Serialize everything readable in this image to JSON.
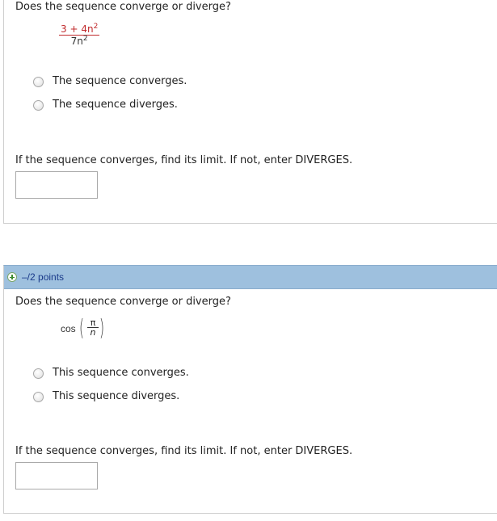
{
  "question1": {
    "prompt": "Does the sequence converge or diverge?",
    "expression": {
      "numerator": "3 + 4n",
      "numerator_exp": "2",
      "denominator": "7n",
      "denominator_exp": "2"
    },
    "options": [
      "The sequence converges.",
      "The sequence diverges."
    ],
    "limit_prompt": "If the sequence converges, find its limit. If not, enter DIVERGES.",
    "answer_value": ""
  },
  "question2": {
    "points": "–/2 points",
    "prompt": "Does the sequence converge or diverge?",
    "expression": {
      "func": "cos",
      "numerator": "π",
      "denominator": "n"
    },
    "options": [
      "This sequence converges.",
      "This sequence diverges."
    ],
    "limit_prompt": "If the sequence converges, find its limit. If not, enter DIVERGES.",
    "answer_value": ""
  },
  "icons": {
    "expand": "plus-circle-icon",
    "radio": "radio-unselected-icon"
  },
  "colors": {
    "header_bar": "#9ec0de",
    "fraction_numerator": "#c0292b",
    "points_text": "#1a3a8a"
  }
}
